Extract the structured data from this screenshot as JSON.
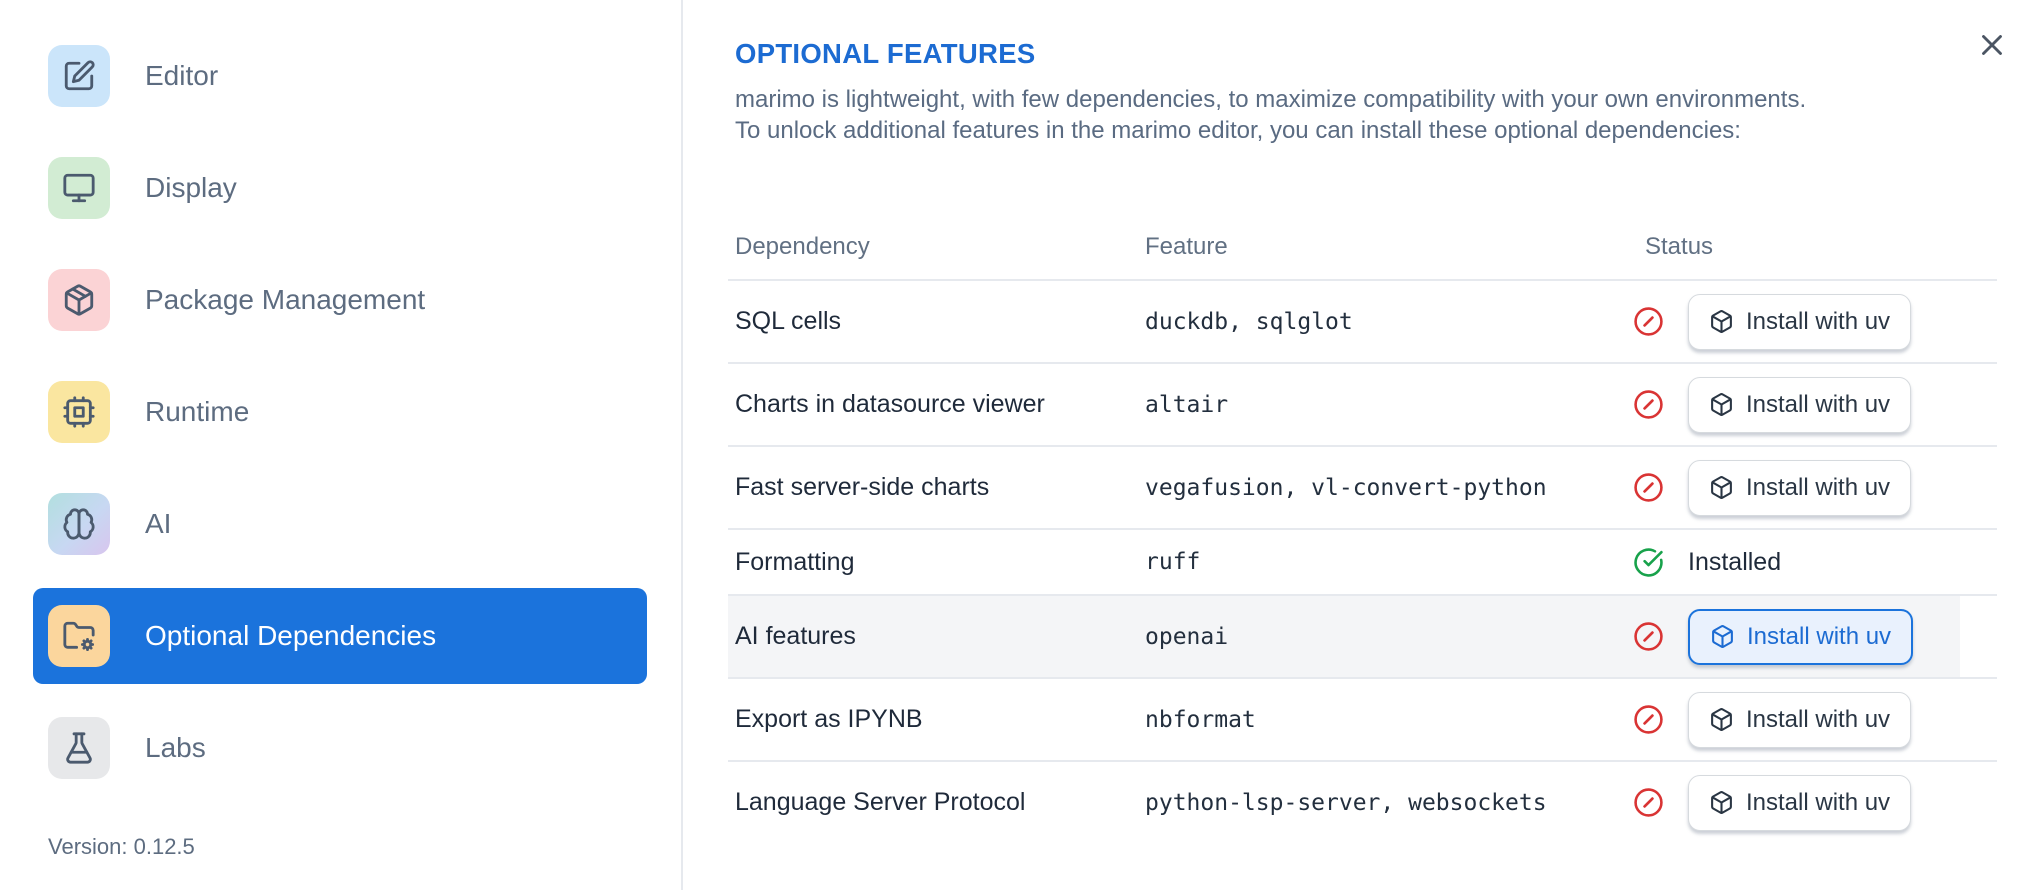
{
  "sidebar": {
    "items": [
      {
        "label": "Editor",
        "icon": "editor",
        "icon_bg": "#cbe5fa",
        "selected": false
      },
      {
        "label": "Display",
        "icon": "display",
        "icon_bg": "#d2ecd3",
        "selected": false
      },
      {
        "label": "Package Management",
        "icon": "package",
        "icon_bg": "#fbd3d5",
        "selected": false
      },
      {
        "label": "Runtime",
        "icon": "cpu",
        "icon_bg": "#fae6a0",
        "selected": false
      },
      {
        "label": "AI",
        "icon": "brain",
        "icon_bg": "linear-gradient(135deg,#b2dfdf 0%,#c7d8f2 55%,#d8c5ee 100%)",
        "selected": false
      },
      {
        "label": "Optional Dependencies",
        "icon": "folder-cog",
        "icon_bg": "#fbd69d",
        "selected": true
      },
      {
        "label": "Labs",
        "icon": "flask",
        "icon_bg": "#e7e8ea",
        "selected": false
      }
    ],
    "version_label": "Version: 0.12.5"
  },
  "main": {
    "title": "OPTIONAL FEATURES",
    "description_line1": "marimo is lightweight, with few dependencies, to maximize compatibility with your own environments.",
    "description_line2": "To unlock additional features in the marimo editor, you can install these optional dependencies:",
    "table": {
      "columns": [
        "Dependency",
        "Feature",
        "Status"
      ],
      "install_button_label": "Install with uv",
      "installed_label": "Installed",
      "rows": [
        {
          "dependency": "SQL cells",
          "feature": "duckdb, sqlglot",
          "installed": false,
          "highlighted": false
        },
        {
          "dependency": "Charts in datasource viewer",
          "feature": "altair",
          "installed": false,
          "highlighted": false
        },
        {
          "dependency": "Fast server-side charts",
          "feature": "vegafusion, vl-convert-python",
          "installed": false,
          "highlighted": false
        },
        {
          "dependency": "Formatting",
          "feature": "ruff",
          "installed": true,
          "highlighted": false
        },
        {
          "dependency": "AI features",
          "feature": "openai",
          "installed": false,
          "highlighted": true
        },
        {
          "dependency": "Export as IPYNB",
          "feature": "nbformat",
          "installed": false,
          "highlighted": false
        },
        {
          "dependency": "Language Server Protocol",
          "feature": "python-lsp-server, websockets",
          "installed": false,
          "highlighted": false
        }
      ]
    }
  },
  "colors": {
    "accent_blue": "#1b73dc",
    "title_blue": "#1c6bd2",
    "status_red": "#d93434",
    "status_green": "#18a24b"
  }
}
